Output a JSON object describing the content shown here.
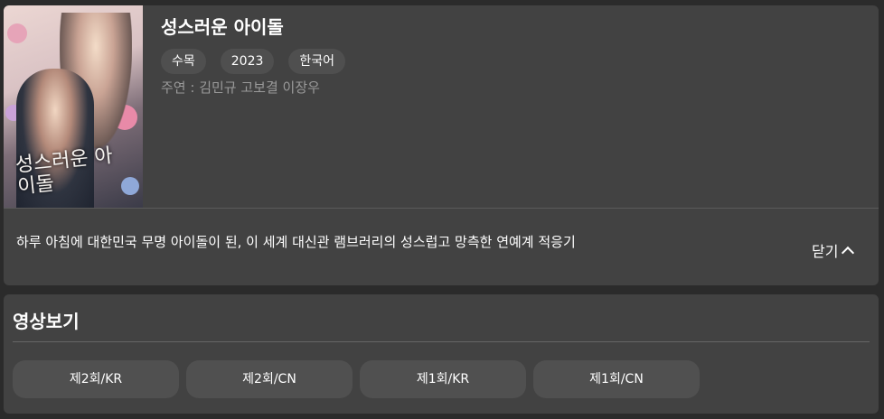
{
  "drama": {
    "title": "성스러운 아이돌",
    "poster_title": "성스러운 아이돌",
    "tags": [
      "수목",
      "2023",
      "한국어"
    ],
    "cast": "주연 : 김민규 고보결 이장우",
    "synopsis": "하루 아침에 대한민국 무명 아이돌이 된, 이 세계 대신관 램브러리의 성스럽고 망측한 연예계 적응기",
    "close_label": "닫기"
  },
  "videos": {
    "heading": "영상보기",
    "episodes": [
      "제2회/KR",
      "제2회/CN",
      "제1회/KR",
      "제1회/CN"
    ]
  },
  "colors": {
    "page_bg": "#2b2b2b",
    "card_bg": "#424242",
    "chip_bg": "#4f4f4f",
    "button_bg": "#505050",
    "muted_text": "#9a9a9a"
  },
  "icons": {
    "close_chevron": "chevron-up-icon"
  }
}
